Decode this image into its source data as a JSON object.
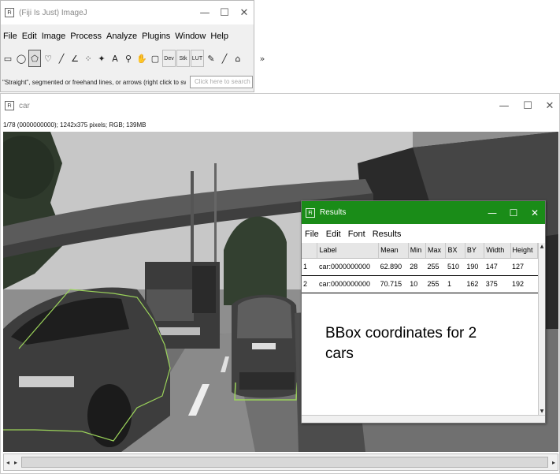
{
  "fiji": {
    "title": "(Fiji Is Just) ImageJ",
    "icon": "fiji-icon",
    "menu": [
      "File",
      "Edit",
      "Image",
      "Process",
      "Analyze",
      "Plugins",
      "Window",
      "Help"
    ],
    "tools": [
      {
        "name": "rectangle-tool",
        "glyph": "▭"
      },
      {
        "name": "oval-tool",
        "glyph": "◯"
      },
      {
        "name": "polygon-tool",
        "glyph": "⬠"
      },
      {
        "name": "freehand-tool",
        "glyph": "♡"
      },
      {
        "name": "line-tool",
        "glyph": "╱"
      },
      {
        "name": "angle-tool",
        "glyph": "∠"
      },
      {
        "name": "point-tool",
        "glyph": "⁘"
      },
      {
        "name": "wand-tool",
        "glyph": "✦"
      },
      {
        "name": "text-tool",
        "glyph": "A"
      },
      {
        "name": "magnifier-tool",
        "glyph": "⚲"
      },
      {
        "name": "hand-tool",
        "glyph": "✋"
      },
      {
        "name": "color-picker-tool",
        "glyph": "▢"
      }
    ],
    "text_tools": [
      "Dev",
      "Stk",
      "LUT"
    ],
    "extra_tools": [
      {
        "name": "brush-tool",
        "glyph": "✎"
      },
      {
        "name": "pencil-tool",
        "glyph": "╱"
      },
      {
        "name": "flood-fill-tool",
        "glyph": "⌂"
      }
    ],
    "more": "»",
    "status": "\"Straight\", segmented or freehand lines, or arrows (right click to switch)",
    "search_placeholder": "Click here to search"
  },
  "image_window": {
    "title": "car",
    "info": "1/78 (0000000000); 1242x375 pixels; RGB; 139MB"
  },
  "results": {
    "title": "Results",
    "menu": [
      "File",
      "Edit",
      "Font",
      "Results"
    ],
    "columns": [
      "",
      "Label",
      "Mean",
      "Min",
      "Max",
      "BX",
      "BY",
      "Width",
      "Height"
    ],
    "rows": [
      [
        "1",
        "car:0000000000",
        "62.890",
        "28",
        "255",
        "510",
        "190",
        "147",
        "127"
      ],
      [
        "2",
        "car:0000000000",
        "70.715",
        "10",
        "255",
        "1",
        "162",
        "375",
        "192"
      ]
    ],
    "annotation": "BBox coordinates for 2 cars"
  },
  "colors": {
    "results_titlebar": "#1a8c18",
    "selection_roi": "#9bd35a"
  }
}
